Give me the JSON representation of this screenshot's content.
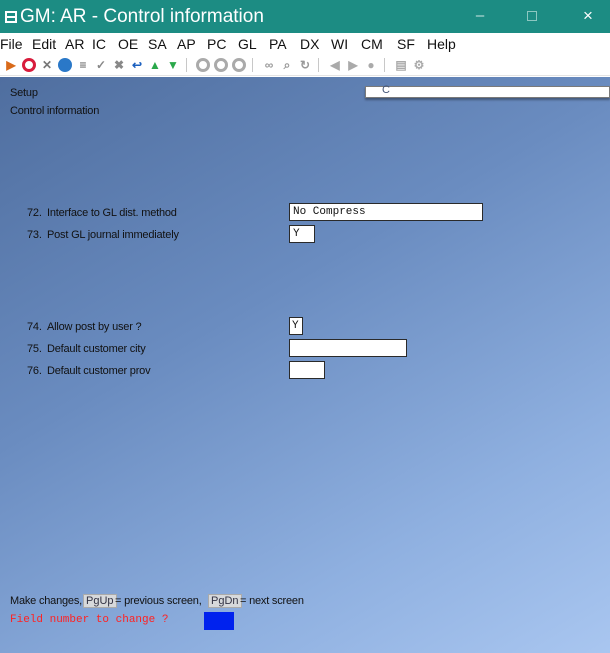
{
  "window": {
    "title": "GM: AR - Control information",
    "controls": {
      "minimize": "–",
      "maximize": "",
      "close": "×"
    }
  },
  "menu": [
    "File",
    "Edit",
    "AR",
    "IC",
    "OE",
    "SA",
    "AP",
    "PC",
    "GL",
    "PA",
    "DX",
    "WI",
    "CM",
    "SF",
    "Help"
  ],
  "toolbar": {
    "icons": [
      "open-icon",
      "stop-icon",
      "tools-icon",
      "globe-icon",
      "list-icon",
      "check-icon",
      "delete-icon",
      "undo-icon",
      "up-arrow-icon",
      "down-arrow-icon",
      "circle-1-icon",
      "circle-2-icon",
      "circle-3-icon",
      "binoculars-icon",
      "zoom-icon",
      "refresh-icon",
      "prev-icon",
      "next-icon",
      "record-icon",
      "calculator-icon",
      "settings-icon"
    ]
  },
  "header": {
    "setup": "Setup",
    "screen_title": "Control information",
    "status_text": "C"
  },
  "fields": [
    {
      "number": "72.",
      "label": "Interface to GL dist. method",
      "value": "No Compress"
    },
    {
      "number": "73.",
      "label": "Post GL journal immediately",
      "value": "Y"
    },
    {
      "number": "74.",
      "label": "Allow post by user ?",
      "value": "Y"
    },
    {
      "number": "75.",
      "label": "Default customer city",
      "value": ""
    },
    {
      "number": "76.",
      "label": "Default customer prov",
      "value": ""
    }
  ],
  "footer": {
    "make_changes": "Make changes,",
    "pgup_key": "PgUp",
    "pgup_desc": "= previous screen,",
    "pgdn_key": "PgDn",
    "pgdn_desc": "= next screen",
    "prompt": "Field number to change ?"
  },
  "colors": {
    "titlebar": "#1c8c83",
    "prompt": "#ff2222",
    "cursor": "#0022ee",
    "background_from": "#4f6e9f",
    "background_to": "#a9c6f0"
  }
}
